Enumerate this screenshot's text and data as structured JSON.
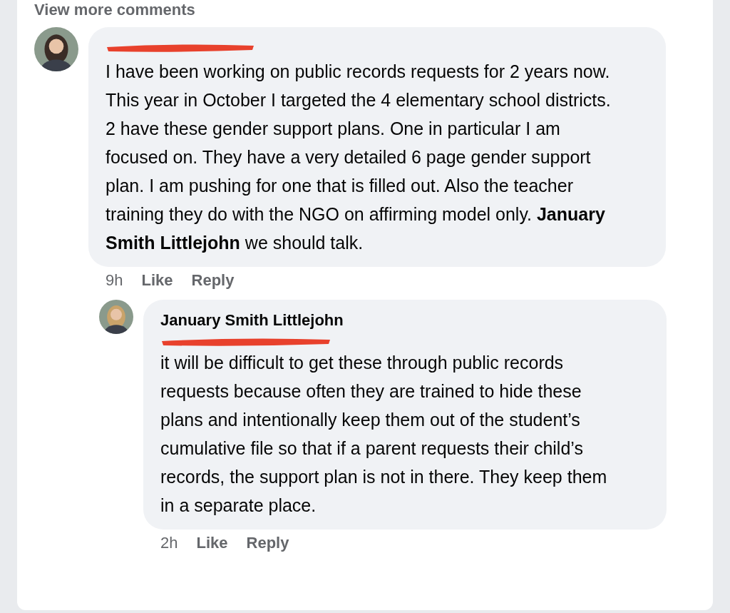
{
  "header": {
    "link": "View more comments"
  },
  "comments": [
    {
      "redacted_author": true,
      "body": "I have been working on public records requests for 2 years now. This year in October I targeted the 4 elementary school districts. 2 have these gender support plans. One in particular I am focused on. They have a very detailed 6 page gender support plan. I am pushing for one that is filled out. Also the teacher training they do with the NGO on affirming model only. **January Smith Littlejohn** we should talk.",
      "time": "9h",
      "actions": [
        "Like",
        "Reply"
      ],
      "replies": [
        {
          "author": "January Smith Littlejohn",
          "redacted_mention": true,
          "body": "it will be difficult to get these through public records requests because often they are trained to hide these plans and intentionally keep them out of the student’s cumulative file so that if a parent requests their child’s records, the support plan is not in there. They keep them in a separate place.",
          "time": "2h",
          "actions": [
            "Like",
            "Reply"
          ]
        }
      ]
    }
  ]
}
